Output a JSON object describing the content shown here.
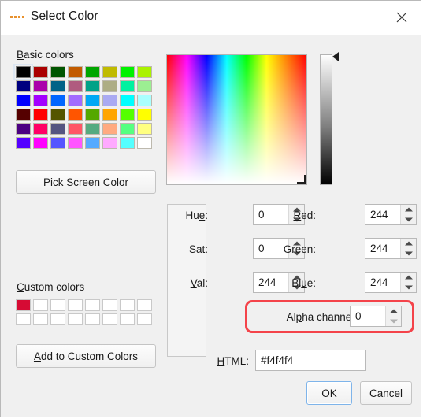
{
  "window": {
    "title": "Select Color",
    "icon": "color-dots-icon",
    "close_icon": "close-icon"
  },
  "basic_colors": {
    "label": "Basic colors",
    "selected_index": 0,
    "colors": [
      "#000000",
      "#aa0000",
      "#005500",
      "#c25b00",
      "#00a600",
      "#c0bb00",
      "#00f200",
      "#aaf200",
      "#00007f",
      "#aa00aa",
      "#006287",
      "#b05b7f",
      "#00a287",
      "#adad84",
      "#00f2a0",
      "#9cef92",
      "#0000ff",
      "#a300ff",
      "#0066ff",
      "#a26bff",
      "#00a8f5",
      "#aaaaf2",
      "#00ffff",
      "#aaffff",
      "#550000",
      "#ff0000",
      "#555500",
      "#ff5500",
      "#55a800",
      "#ffa500",
      "#55ff00",
      "#ffff00",
      "#4b0082",
      "#ff0066",
      "#555580",
      "#ff5566",
      "#55aa80",
      "#ffaa80",
      "#55ff80",
      "#ffff80",
      "#5500ff",
      "#ff00ff",
      "#5555ff",
      "#ff55ff",
      "#55aaff",
      "#ffaaff",
      "#55ffff",
      "#ffffff"
    ]
  },
  "pick_screen_color": {
    "label_before": "P",
    "label_after": "ick Screen Color"
  },
  "custom_colors": {
    "label": "Custom colors",
    "count": 16,
    "filled": [
      "#d60b34"
    ]
  },
  "add_to_custom_colors": {
    "label_before": "A",
    "label_after": "dd to Custom Colors"
  },
  "preview": {
    "color": "#f4f4f4"
  },
  "fields": [
    {
      "name": "hue",
      "label_pre": "Hu",
      "label_key": "e",
      "label_post": ":",
      "value": "0"
    },
    {
      "name": "red",
      "label_pre": "",
      "label_key": "R",
      "label_post": "ed:",
      "value": "244"
    },
    {
      "name": "sat",
      "label_pre": "",
      "label_key": "S",
      "label_post": "at:",
      "value": "0"
    },
    {
      "name": "green",
      "label_pre": "",
      "label_key": "G",
      "label_post": "reen:",
      "value": "244"
    },
    {
      "name": "val",
      "label_pre": "",
      "label_key": "V",
      "label_post": "al:",
      "value": "244"
    },
    {
      "name": "blue",
      "label_pre": "Bl",
      "label_key": "u",
      "label_post": "e:",
      "value": "244"
    }
  ],
  "alpha": {
    "label_pre": "Al",
    "label_key": "p",
    "label_post": "ha channel:",
    "value": "0",
    "highlight_color": "#f4434a"
  },
  "html": {
    "label_pre": "",
    "label_key": "H",
    "label_post": "TML:",
    "value": "#f4f4f4"
  },
  "buttons": {
    "ok": "OK",
    "cancel": "Cancel"
  },
  "color_field": {
    "cursor_position": "bottom-right"
  }
}
